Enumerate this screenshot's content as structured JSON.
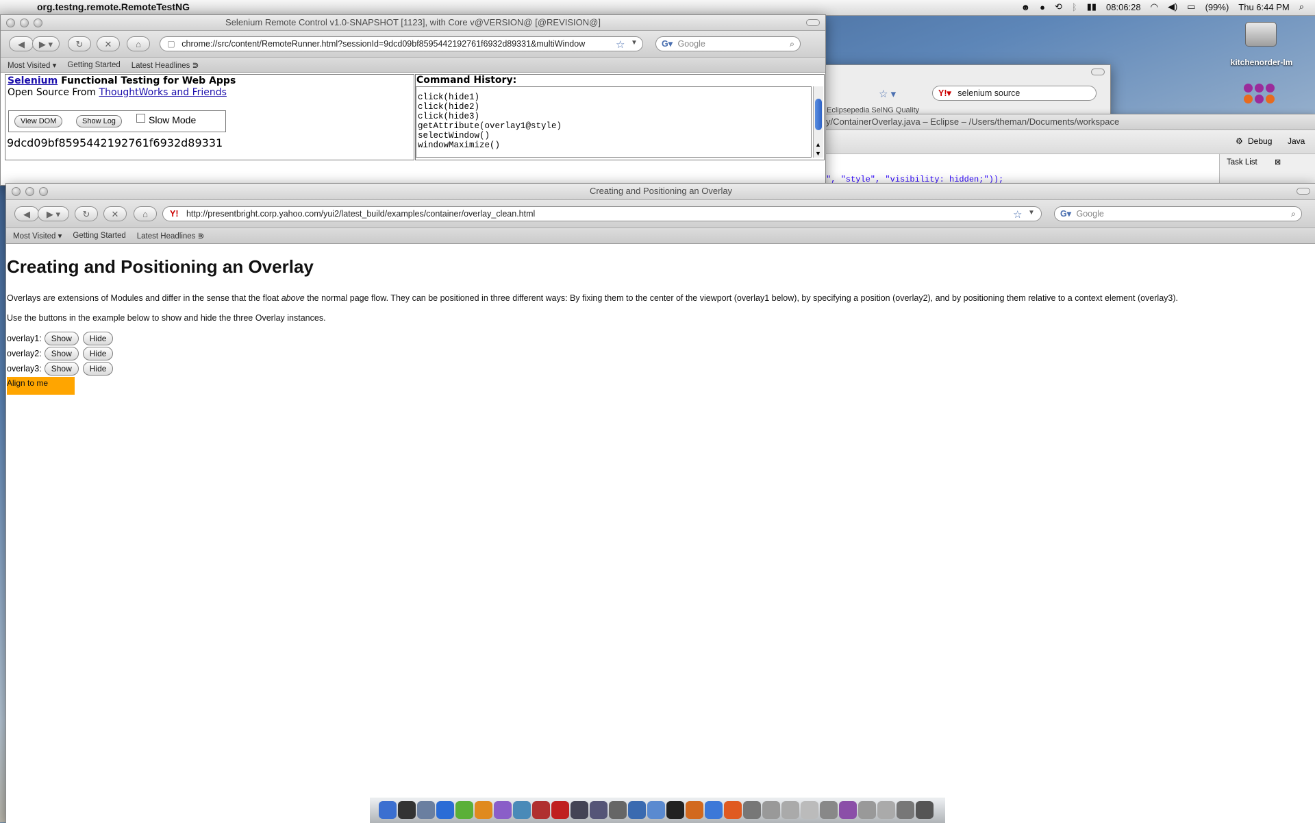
{
  "menubar": {
    "apple_glyph": "",
    "app_name": "org.testng.remote.RemoteTestNG",
    "clock": "08:06:28",
    "battery": "(99%)",
    "datetime": "Thu 6:44 PM"
  },
  "desktop": {
    "drive_label": "kitchenorder-lm"
  },
  "bg_browser": {
    "search_text": "selenium source",
    "bookmark_partial": "Eclipsepedia    SelNG    Quality"
  },
  "eclipse": {
    "title": "y/ContainerOverlay.java – Eclipse – /Users/theman/Documents/workspace",
    "debug_label": "Debug",
    "java_label": "Java",
    "tasklist_label": "Task List",
    "code_line": "\", \"style\", \"visibility: hidden;\"));"
  },
  "selenium_window": {
    "title": "Selenium Remote Control v1.0-SNAPSHOT [1123], with Core v@VERSION@ [@REVISION@]",
    "url": "chrome://src/content/RemoteRunner.html?sessionId=9dcd09bf8595442192761f6932d89331&multiWindow",
    "search_placeholder": "Google",
    "bookmarks": [
      "Most Visited ▾",
      "Getting Started",
      "Latest Headlines ⋑"
    ],
    "brand_link": "Selenium",
    "brand_tail": " Functional Testing for Web Apps",
    "source_prefix": "Open Source From ",
    "source_link": "ThoughtWorks and Friends",
    "view_dom": "View DOM",
    "show_log": "Show Log",
    "slow_mode": "Slow Mode",
    "session_id": "9dcd09bf8595442192761f6932d89331",
    "history_label": "Command History:",
    "history": [
      "click(hide1)",
      "click(hide2)",
      "click(hide3)",
      "getAttribute(overlay1@style)",
      "selectWindow()",
      "windowMaximize()"
    ]
  },
  "yui_window": {
    "title": "Creating and Positioning an Overlay",
    "url": "http://presentbright.corp.yahoo.com/yui2/latest_build/examples/container/overlay_clean.html",
    "search_placeholder": "Google",
    "bookmarks": [
      "Most Visited ▾",
      "Getting Started",
      "Latest Headlines ⋑"
    ],
    "heading": "Creating and Positioning an Overlay",
    "para1_a": "Overlays are extensions of Modules and differ in the sense that the float ",
    "para1_em": "above",
    "para1_b": " the normal page flow. They can be positioned in three different ways: By fixing them to the center of the viewport (overlay1 below), by specifying a position (overlay2), and by positioning them relative to a context element (overlay3).",
    "para2": "Use the buttons in the example below to show and hide the three Overlay instances.",
    "rows": [
      {
        "label": "overlay1:",
        "show": "Show",
        "hide": "Hide"
      },
      {
        "label": "overlay2:",
        "show": "Show",
        "hide": "Hide"
      },
      {
        "label": "overlay3:",
        "show": "Show",
        "hide": "Hide"
      }
    ],
    "align_box": "Align to me",
    "align_color": "#FFA500"
  },
  "colors": {
    "link": "#1a0dab",
    "accent_orange": "#FFA500"
  }
}
